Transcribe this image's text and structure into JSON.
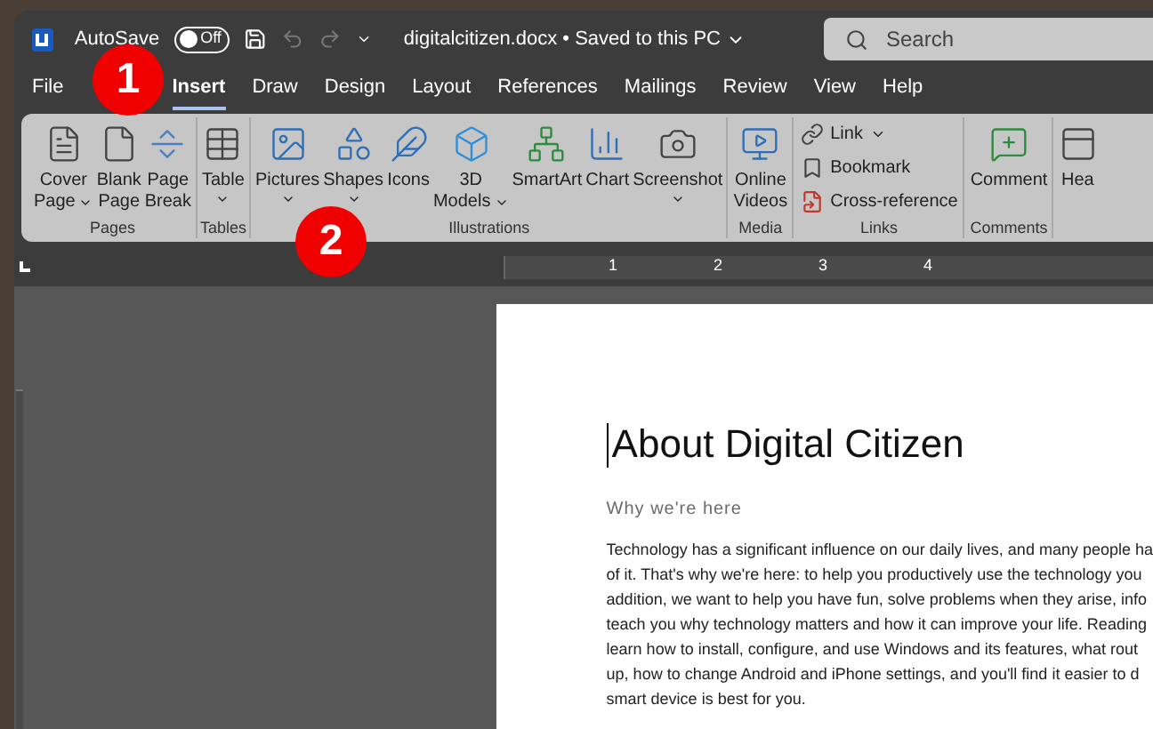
{
  "title_bar": {
    "autosave_label": "AutoSave",
    "autosave": {
      "on": false,
      "label": "Off"
    },
    "document_title": "digitalcitizen.docx • Saved to this PC",
    "search": {
      "placeholder": "Search"
    }
  },
  "tabs": [
    {
      "label": "File",
      "selected": false
    },
    {
      "label": "Insert",
      "selected": true
    },
    {
      "label": "Draw",
      "selected": false
    },
    {
      "label": "Design",
      "selected": false
    },
    {
      "label": "Layout",
      "selected": false
    },
    {
      "label": "References",
      "selected": false
    },
    {
      "label": "Mailings",
      "selected": false
    },
    {
      "label": "Review",
      "selected": false
    },
    {
      "label": "View",
      "selected": false
    },
    {
      "label": "Help",
      "selected": false
    }
  ],
  "ribbon": {
    "groups": [
      {
        "label": "Pages",
        "items": [
          {
            "kind": "large",
            "lines": [
              "Cover",
              "Page"
            ],
            "dropdown": true
          },
          {
            "kind": "large",
            "lines": [
              "Blank",
              "Page"
            ],
            "dropdown": false
          },
          {
            "kind": "large",
            "lines": [
              "Page",
              "Break"
            ],
            "dropdown": false
          }
        ]
      },
      {
        "label": "Tables",
        "items": [
          {
            "kind": "large",
            "lines": [
              "Table"
            ],
            "dropdown": true
          }
        ]
      },
      {
        "label": "Illustrations",
        "items": [
          {
            "kind": "large",
            "lines": [
              "Pictures"
            ],
            "dropdown": true
          },
          {
            "kind": "large",
            "lines": [
              "Shapes"
            ],
            "dropdown": true
          },
          {
            "kind": "large",
            "lines": [
              "Icons"
            ],
            "dropdown": false
          },
          {
            "kind": "large",
            "lines": [
              "3D",
              "Models"
            ],
            "dropdown": true
          },
          {
            "kind": "large",
            "lines": [
              "SmartArt"
            ],
            "dropdown": false
          },
          {
            "kind": "large",
            "lines": [
              "Chart"
            ],
            "dropdown": false
          },
          {
            "kind": "large",
            "lines": [
              "Screenshot"
            ],
            "dropdown": true
          }
        ]
      },
      {
        "label": "Media",
        "items": [
          {
            "kind": "large",
            "lines": [
              "Online",
              "Videos"
            ],
            "dropdown": false
          }
        ]
      },
      {
        "label": "Links",
        "items": [
          {
            "kind": "small",
            "lines": [
              "Link"
            ],
            "dropdown": true
          },
          {
            "kind": "small",
            "lines": [
              "Bookmark"
            ],
            "dropdown": false
          },
          {
            "kind": "small",
            "lines": [
              "Cross-reference"
            ],
            "dropdown": false
          }
        ]
      },
      {
        "label": "Comments",
        "items": [
          {
            "kind": "large",
            "lines": [
              "Comment"
            ],
            "dropdown": false
          }
        ]
      },
      {
        "items": [
          {
            "kind": "large",
            "lines": [
              "Hea"
            ],
            "dropdown": false
          }
        ]
      }
    ]
  },
  "ruler": {
    "numbers": [
      "1",
      "2",
      "3",
      "4"
    ]
  },
  "document": {
    "title": "About Digital Citizen",
    "heading": "Why we're here",
    "lines": [
      "Technology has a significant influence on our daily lives, and many people ha",
      "of it. That's why we're here: to help you productively use the technology you",
      "addition, we want to help you have fun, solve problems when they arise, info",
      "teach you why technology matters and how it can improve your life. Reading",
      "learn how to install, configure, and use Windows and its features, what rout",
      "up, how to change Android and iPhone settings, and you'll find it easier to d",
      "smart device is best for you."
    ]
  },
  "annotations": [
    {
      "label": "1"
    },
    {
      "label": "2"
    }
  ]
}
